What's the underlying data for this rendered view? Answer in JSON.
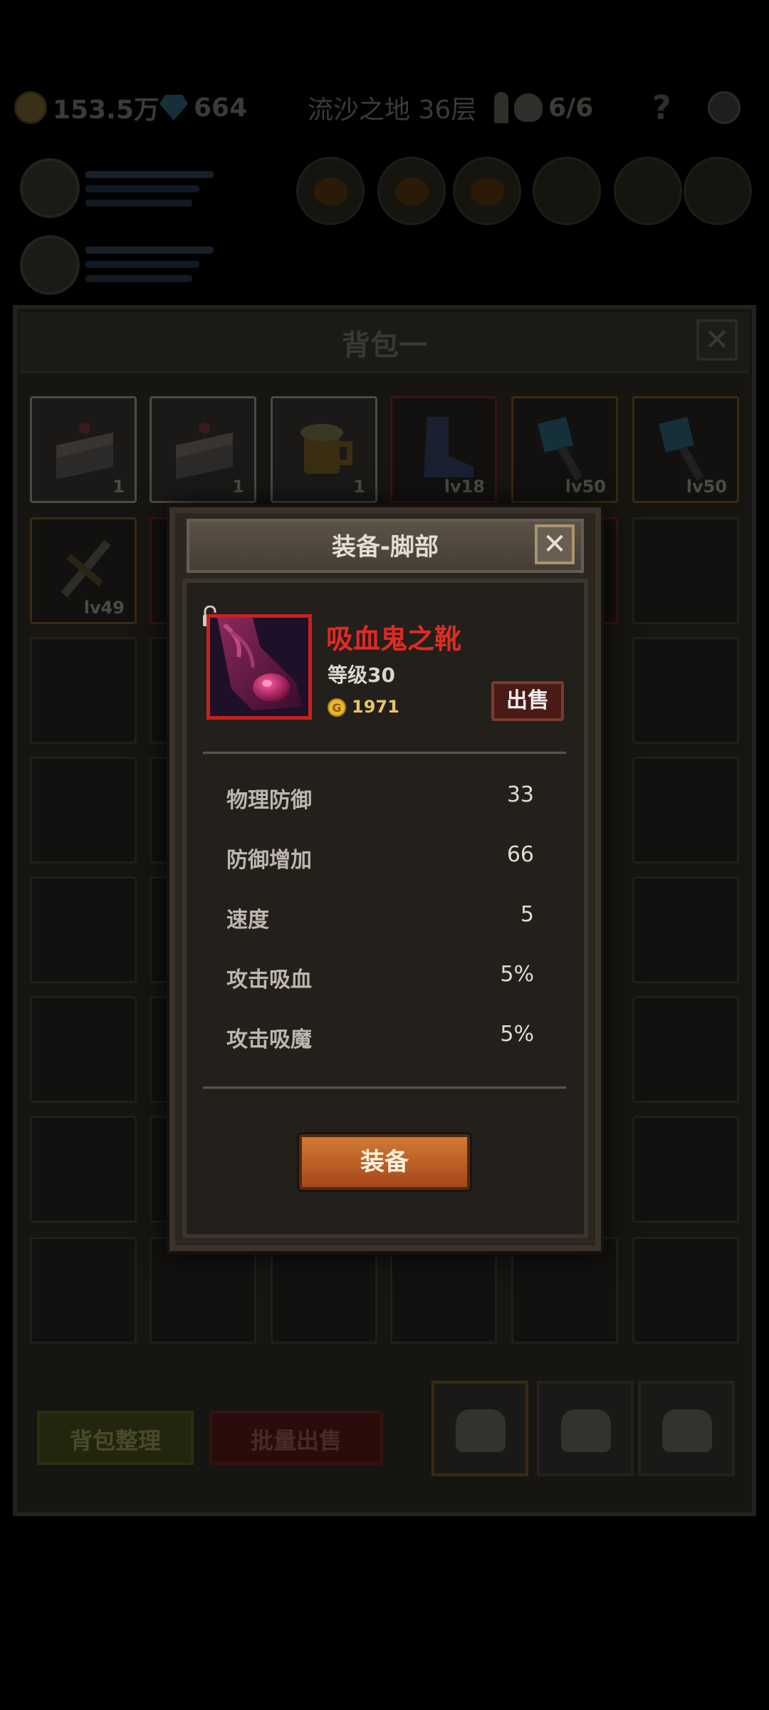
{
  "status_bar": {
    "gold": "153.5万",
    "gems": "664",
    "location": "流沙之地 36层",
    "keys_skulls": "6/6"
  },
  "bag": {
    "title": "背包一",
    "close_label": "✕",
    "items": [
      {
        "label": "1",
        "art": "cake-icon"
      },
      {
        "label": "1",
        "art": "cake-icon"
      },
      {
        "label": "1",
        "art": "beer-mug-icon"
      },
      {
        "label": "lv18",
        "art": "boot-icon"
      },
      {
        "label": "lv50",
        "art": "mace-icon"
      },
      {
        "label": "lv50",
        "art": "mace-icon"
      },
      {
        "label": "lv49",
        "art": "sword-icon"
      }
    ],
    "sort_label": "背包整理",
    "bulk_sell_label": "批量出售"
  },
  "modal": {
    "title": "装备-脚部",
    "close_label": "✕",
    "item": {
      "name": "吸血鬼之靴",
      "level": "等级30",
      "price": "1971",
      "coin_glyph": "G",
      "name_color": "#e02b22",
      "art": "vampire-boots-icon"
    },
    "sell_label": "出售",
    "stats": [
      {
        "label": "物理防御",
        "value": "33"
      },
      {
        "label": "防御增加",
        "value": "66"
      },
      {
        "label": "速度",
        "value": "5"
      },
      {
        "label": "攻击吸血",
        "value": "5%"
      },
      {
        "label": "攻击吸魔",
        "value": "5%"
      }
    ],
    "equip_label": "装备"
  }
}
